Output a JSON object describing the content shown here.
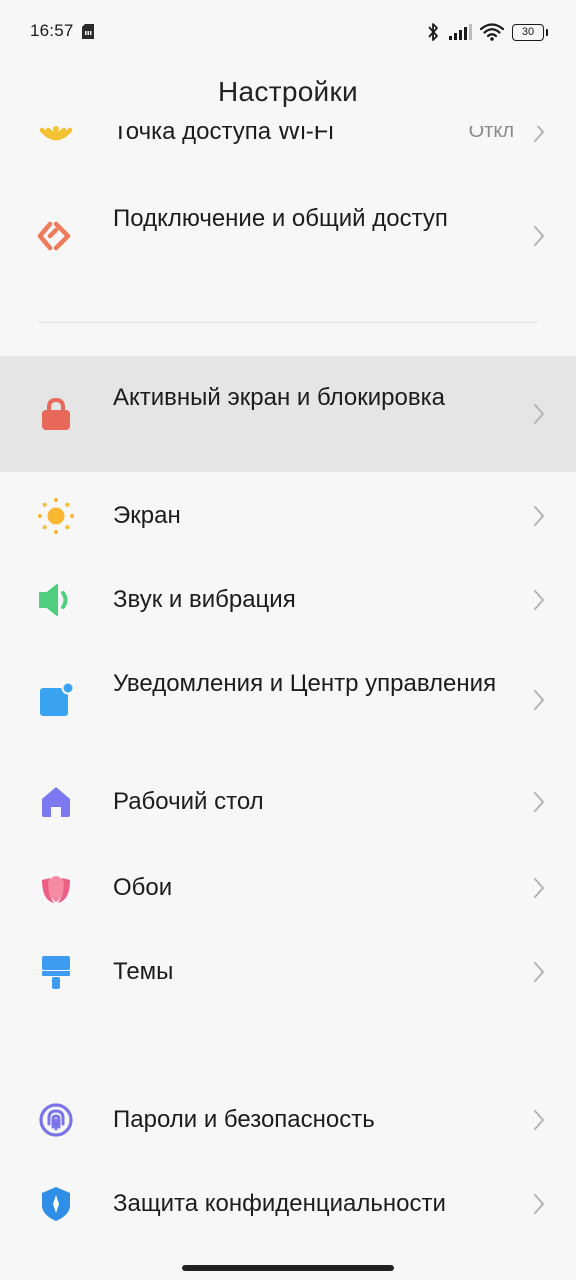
{
  "status_bar": {
    "time": "16:57",
    "battery_level": "30",
    "icons": [
      "sd-card-icon",
      "bluetooth-icon",
      "signal-icon",
      "wifi-icon",
      "battery-icon"
    ]
  },
  "header": {
    "title": "Настройки"
  },
  "items": [
    {
      "id": "hotspot",
      "label": "Точка доступа Wi-Fi",
      "value": "Откл",
      "icon": "hotspot-icon",
      "color": "#f2c233"
    },
    {
      "id": "connection-sharing",
      "label": "Подключение и общий доступ",
      "icon": "connection-sharing-icon",
      "color": "#ee7b5c"
    },
    {
      "id": "lock-screen",
      "label": "Активный экран и блокировка",
      "icon": "lock-icon",
      "color": "#e8685a"
    },
    {
      "id": "display",
      "label": "Экран",
      "icon": "sun-icon",
      "color": "#f7b731"
    },
    {
      "id": "sound",
      "label": "Звук и вибрация",
      "icon": "speaker-icon",
      "color": "#4fce7f"
    },
    {
      "id": "notifications",
      "label": "Уведомления и Центр управления",
      "icon": "notification-icon",
      "color": "#3aa3f2"
    },
    {
      "id": "home-screen",
      "label": "Рабочий стол",
      "icon": "home-icon",
      "color": "#7c79f0"
    },
    {
      "id": "wallpaper",
      "label": "Обои",
      "icon": "tulip-icon",
      "color": "#ec5f82"
    },
    {
      "id": "themes",
      "label": "Темы",
      "icon": "paint-brush-icon",
      "color": "#3d9cf1"
    },
    {
      "id": "passwords-security",
      "label": "Пароли и безопасность",
      "icon": "fingerprint-icon",
      "color": "#7b74e8"
    },
    {
      "id": "privacy",
      "label": "Защита конфиденциальности",
      "icon": "privacy-shield-icon",
      "color": "#2f8fe6"
    }
  ]
}
